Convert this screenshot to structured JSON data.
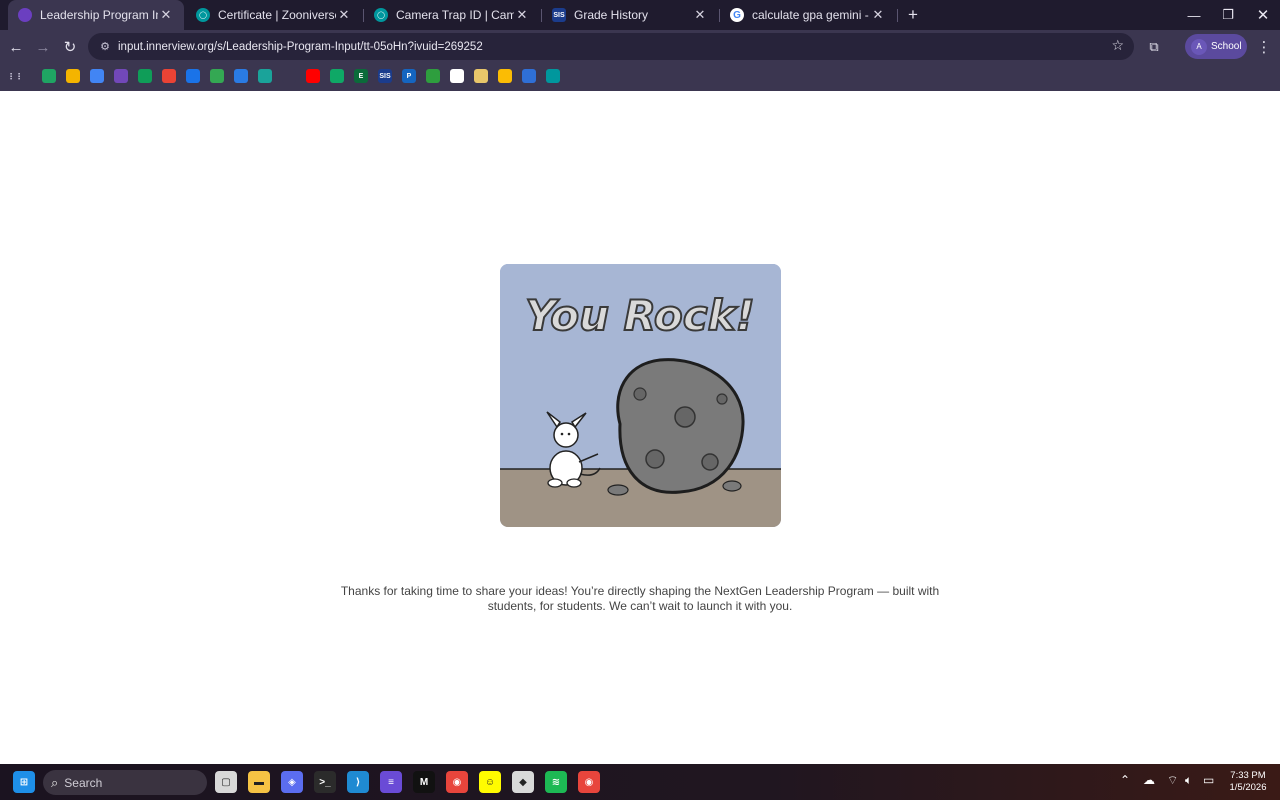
{
  "tabs": [
    {
      "title": "Leadership Program Input",
      "active": true,
      "favicon": "innerview-icon",
      "favicon_color": "#6b3fc0"
    },
    {
      "title": "Certificate | Zooniverse",
      "active": false,
      "favicon": "zooniverse-icon",
      "favicon_color": "#00979d"
    },
    {
      "title": "Camera Trap ID | Cameras for Conservation",
      "active": false,
      "favicon": "zooniverse-icon",
      "favicon_color": "#00979d"
    },
    {
      "title": "Grade History",
      "active": false,
      "favicon": "sis-icon",
      "favicon_color": "#1b3c8c",
      "favicon_text": "SIS"
    },
    {
      "title": "calculate gpa gemini - Google Search",
      "active": false,
      "favicon": "google-icon",
      "favicon_color": "#ffffff"
    }
  ],
  "toolbar": {
    "url": "input.innerview.org/s/Leadership-Program-Input/tt-05oHn?ivuid=269252",
    "profile_initial": "A",
    "profile_label": "School"
  },
  "bookmarks": [
    {
      "name": "apps-grid-icon",
      "color": "#3b3650"
    },
    {
      "name": "google-drive-icon",
      "color": "#1fa463"
    },
    {
      "name": "google-slides-icon",
      "color": "#f4b400"
    },
    {
      "name": "google-docs-icon",
      "color": "#4285f4"
    },
    {
      "name": "google-forms-icon",
      "color": "#7248b9"
    },
    {
      "name": "google-sheets-icon",
      "color": "#0f9d58"
    },
    {
      "name": "gmail-icon",
      "color": "#ea4335"
    },
    {
      "name": "globe-icon",
      "color": "#1a73e8"
    },
    {
      "name": "google-maps-icon",
      "color": "#34a853"
    },
    {
      "name": "bookmark-app-icon",
      "color": "#2a7be4"
    },
    {
      "name": "bookmark-app-icon",
      "color": "#1aa39a"
    },
    {
      "name": "openai-icon",
      "color": "#3b3650"
    },
    {
      "name": "youtube-icon",
      "color": "#ff0000"
    },
    {
      "name": "bookmark-app-icon",
      "color": "#0fa866"
    },
    {
      "name": "bookmark-e-icon",
      "color": "#0b6b3a",
      "text": "E"
    },
    {
      "name": "sis-icon",
      "color": "#1b3c8c",
      "text": "SIS"
    },
    {
      "name": "bookmark-p-icon",
      "color": "#1565c0",
      "text": "P"
    },
    {
      "name": "bookmark-flag-icon",
      "color": "#2e9e3e"
    },
    {
      "name": "bookmark-app-icon",
      "color": "#ffffff"
    },
    {
      "name": "bookmark-app-icon",
      "color": "#e8c66a"
    },
    {
      "name": "google-keep-icon",
      "color": "#fbbc04"
    },
    {
      "name": "bookmark-app-icon",
      "color": "#2f6fd6"
    },
    {
      "name": "zooniverse-icon",
      "color": "#00979d"
    }
  ],
  "main": {
    "image_title": "You Rock!",
    "thanks_text": "Thanks for taking  time to share your ideas! You’re directly shaping the NextGen Leadership Program — built with students, for students. We can’t wait to launch it with you."
  },
  "taskbar": {
    "search_label": "Search",
    "apps": [
      {
        "name": "task-view-icon",
        "color": "#d8d8d8"
      },
      {
        "name": "file-explorer-icon",
        "color": "#f6c344"
      },
      {
        "name": "copilot-icon",
        "color": "#5b6df0"
      },
      {
        "name": "terminal-icon",
        "color": "#2b2b2b"
      },
      {
        "name": "vscode-icon",
        "color": "#1f8ad2"
      },
      {
        "name": "app-icon",
        "color": "#6a4bd6"
      },
      {
        "name": "app-icon",
        "color": "#111111"
      },
      {
        "name": "chrome-icon",
        "color": "#e8453c"
      },
      {
        "name": "snapchat-icon",
        "color": "#fffc00"
      },
      {
        "name": "roblox-icon",
        "color": "#d9d9d9"
      },
      {
        "name": "spotify-icon",
        "color": "#1db954"
      },
      {
        "name": "chrome-icon",
        "color": "#e8453c"
      }
    ],
    "clock_time": "7:33 PM",
    "clock_date": "1/5/2026"
  }
}
